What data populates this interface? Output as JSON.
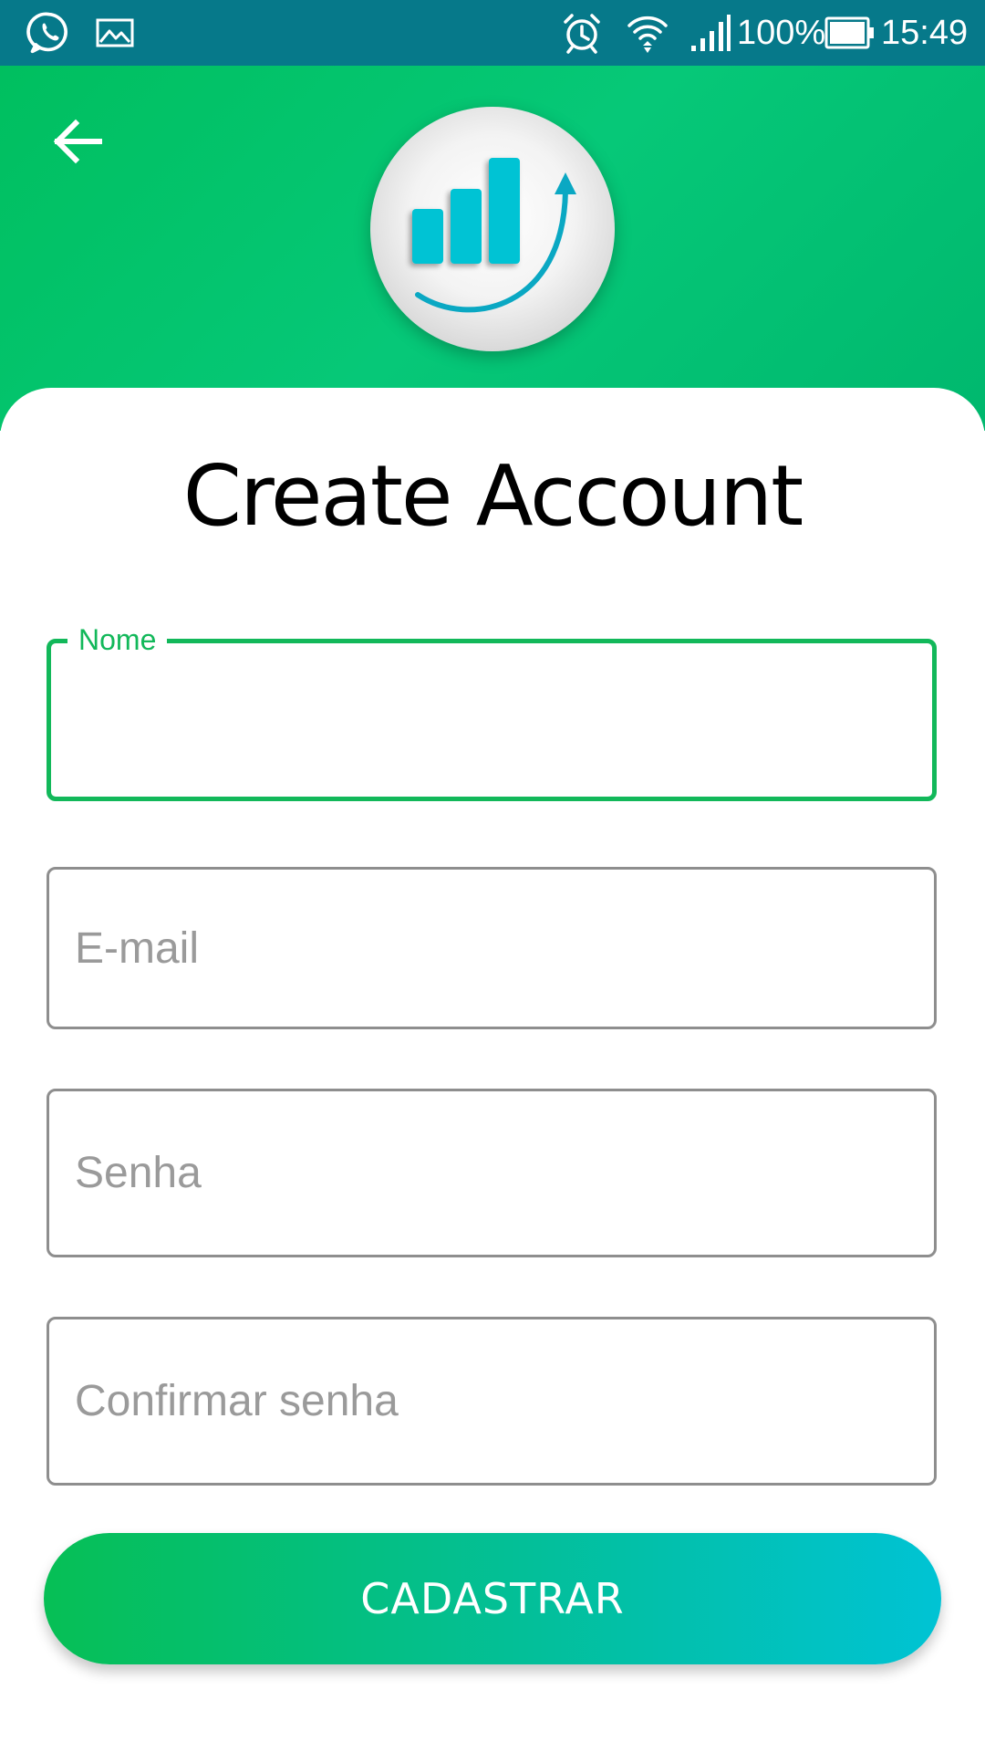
{
  "status_bar": {
    "battery_percent": "100%",
    "time": "15:49",
    "icons": [
      "whatsapp-icon",
      "gallery-icon",
      "alarm-icon",
      "wifi-icon",
      "signal-icon",
      "battery-icon"
    ]
  },
  "header": {
    "back_icon": "arrow-left-icon",
    "logo_icon": "bar-chart-growth-icon"
  },
  "form": {
    "title": "Create Account",
    "fields": [
      {
        "label": "Nome",
        "value": "",
        "placeholder": ""
      },
      {
        "placeholder": "E-mail",
        "value": ""
      },
      {
        "placeholder": "Senha",
        "value": ""
      },
      {
        "placeholder": "Confirmar senha",
        "value": ""
      }
    ],
    "submit_label": "CADASTRAR"
  },
  "colors": {
    "status_bar": "#06798a",
    "header_green": "#00bf5f",
    "focus_green": "#12b85a",
    "logo_cyan": "#00c3d4",
    "button_start": "#06bf55",
    "button_end": "#00c3d4"
  }
}
